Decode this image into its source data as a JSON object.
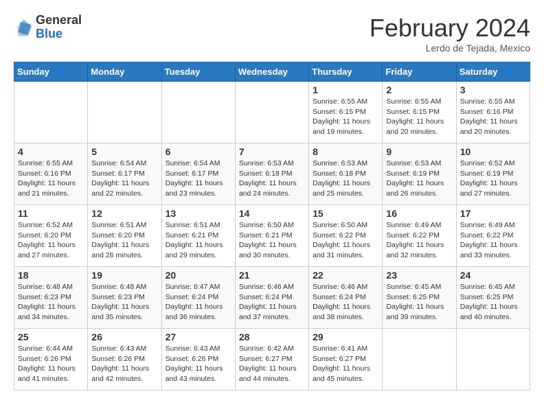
{
  "header": {
    "logo": {
      "general": "General",
      "blue": "Blue"
    },
    "title": "February 2024",
    "location": "Lerdo de Tejada, Mexico"
  },
  "days_of_week": [
    "Sunday",
    "Monday",
    "Tuesday",
    "Wednesday",
    "Thursday",
    "Friday",
    "Saturday"
  ],
  "weeks": [
    [
      {
        "day": "",
        "info": ""
      },
      {
        "day": "",
        "info": ""
      },
      {
        "day": "",
        "info": ""
      },
      {
        "day": "",
        "info": ""
      },
      {
        "day": "1",
        "info": "Sunrise: 6:55 AM\nSunset: 6:15 PM\nDaylight: 11 hours and 19 minutes."
      },
      {
        "day": "2",
        "info": "Sunrise: 6:55 AM\nSunset: 6:15 PM\nDaylight: 11 hours and 20 minutes."
      },
      {
        "day": "3",
        "info": "Sunrise: 6:55 AM\nSunset: 6:16 PM\nDaylight: 11 hours and 20 minutes."
      }
    ],
    [
      {
        "day": "4",
        "info": "Sunrise: 6:55 AM\nSunset: 6:16 PM\nDaylight: 11 hours and 21 minutes."
      },
      {
        "day": "5",
        "info": "Sunrise: 6:54 AM\nSunset: 6:17 PM\nDaylight: 11 hours and 22 minutes."
      },
      {
        "day": "6",
        "info": "Sunrise: 6:54 AM\nSunset: 6:17 PM\nDaylight: 11 hours and 23 minutes."
      },
      {
        "day": "7",
        "info": "Sunrise: 6:53 AM\nSunset: 6:18 PM\nDaylight: 11 hours and 24 minutes."
      },
      {
        "day": "8",
        "info": "Sunrise: 6:53 AM\nSunset: 6:18 PM\nDaylight: 11 hours and 25 minutes."
      },
      {
        "day": "9",
        "info": "Sunrise: 6:53 AM\nSunset: 6:19 PM\nDaylight: 11 hours and 26 minutes."
      },
      {
        "day": "10",
        "info": "Sunrise: 6:52 AM\nSunset: 6:19 PM\nDaylight: 11 hours and 27 minutes."
      }
    ],
    [
      {
        "day": "11",
        "info": "Sunrise: 6:52 AM\nSunset: 6:20 PM\nDaylight: 11 hours and 27 minutes."
      },
      {
        "day": "12",
        "info": "Sunrise: 6:51 AM\nSunset: 6:20 PM\nDaylight: 11 hours and 28 minutes."
      },
      {
        "day": "13",
        "info": "Sunrise: 6:51 AM\nSunset: 6:21 PM\nDaylight: 11 hours and 29 minutes."
      },
      {
        "day": "14",
        "info": "Sunrise: 6:50 AM\nSunset: 6:21 PM\nDaylight: 11 hours and 30 minutes."
      },
      {
        "day": "15",
        "info": "Sunrise: 6:50 AM\nSunset: 6:22 PM\nDaylight: 11 hours and 31 minutes."
      },
      {
        "day": "16",
        "info": "Sunrise: 6:49 AM\nSunset: 6:22 PM\nDaylight: 11 hours and 32 minutes."
      },
      {
        "day": "17",
        "info": "Sunrise: 6:49 AM\nSunset: 6:22 PM\nDaylight: 11 hours and 33 minutes."
      }
    ],
    [
      {
        "day": "18",
        "info": "Sunrise: 6:48 AM\nSunset: 6:23 PM\nDaylight: 11 hours and 34 minutes."
      },
      {
        "day": "19",
        "info": "Sunrise: 6:48 AM\nSunset: 6:23 PM\nDaylight: 11 hours and 35 minutes."
      },
      {
        "day": "20",
        "info": "Sunrise: 6:47 AM\nSunset: 6:24 PM\nDaylight: 11 hours and 36 minutes."
      },
      {
        "day": "21",
        "info": "Sunrise: 6:46 AM\nSunset: 6:24 PM\nDaylight: 11 hours and 37 minutes."
      },
      {
        "day": "22",
        "info": "Sunrise: 6:46 AM\nSunset: 6:24 PM\nDaylight: 11 hours and 38 minutes."
      },
      {
        "day": "23",
        "info": "Sunrise: 6:45 AM\nSunset: 6:25 PM\nDaylight: 11 hours and 39 minutes."
      },
      {
        "day": "24",
        "info": "Sunrise: 6:45 AM\nSunset: 6:25 PM\nDaylight: 11 hours and 40 minutes."
      }
    ],
    [
      {
        "day": "25",
        "info": "Sunrise: 6:44 AM\nSunset: 6:26 PM\nDaylight: 11 hours and 41 minutes."
      },
      {
        "day": "26",
        "info": "Sunrise: 6:43 AM\nSunset: 6:26 PM\nDaylight: 11 hours and 42 minutes."
      },
      {
        "day": "27",
        "info": "Sunrise: 6:43 AM\nSunset: 6:26 PM\nDaylight: 11 hours and 43 minutes."
      },
      {
        "day": "28",
        "info": "Sunrise: 6:42 AM\nSunset: 6:27 PM\nDaylight: 11 hours and 44 minutes."
      },
      {
        "day": "29",
        "info": "Sunrise: 6:41 AM\nSunset: 6:27 PM\nDaylight: 11 hours and 45 minutes."
      },
      {
        "day": "",
        "info": ""
      },
      {
        "day": "",
        "info": ""
      }
    ]
  ]
}
